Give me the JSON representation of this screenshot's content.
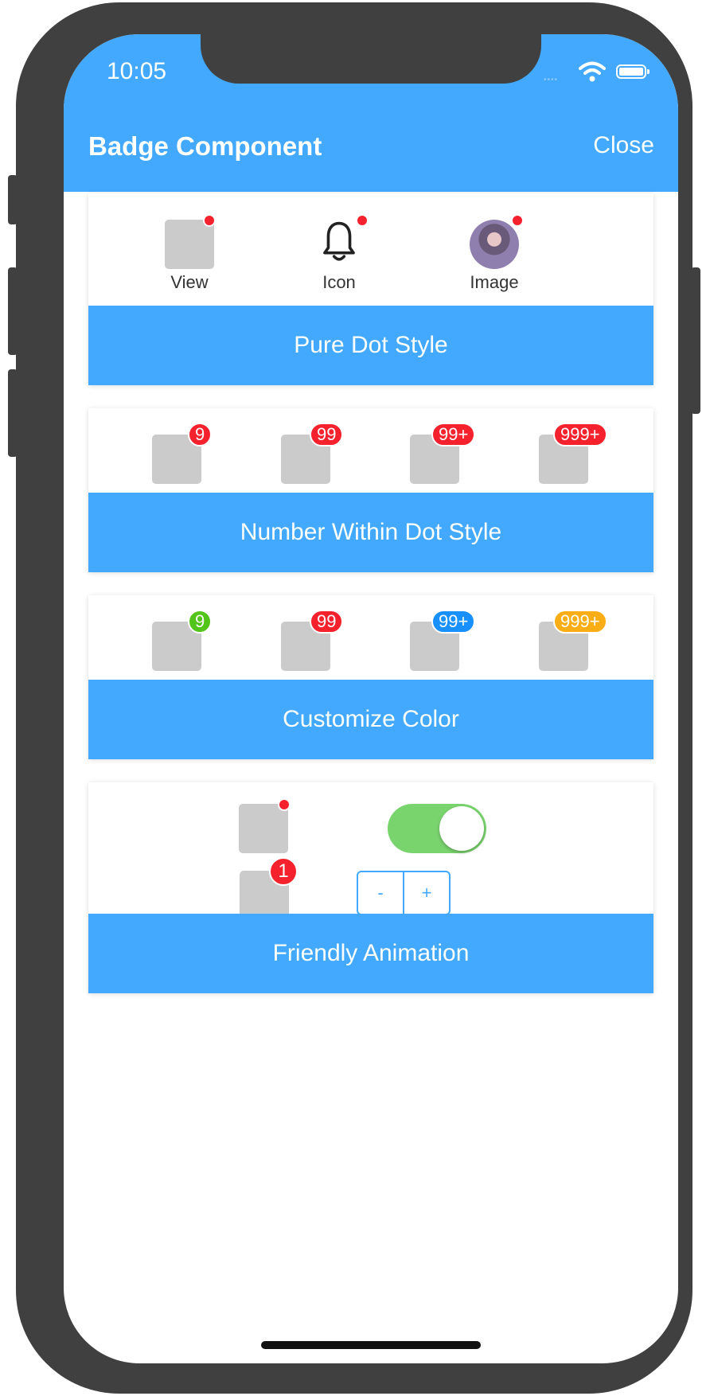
{
  "status_bar": {
    "time": "10:05",
    "signal": "••••"
  },
  "navbar": {
    "title": "Badge Component",
    "close_label": "Close"
  },
  "colors": {
    "primary": "#42a9fe",
    "red": "#f5222d",
    "green": "#52c41a",
    "blue": "#1890ff",
    "orange": "#faad14",
    "switch_on": "#7ad46e"
  },
  "section_dot": {
    "items": [
      {
        "label": "View"
      },
      {
        "label": "Icon",
        "icon": "bell-icon"
      },
      {
        "label": "Image"
      }
    ],
    "footer": "Pure Dot Style"
  },
  "section_number": {
    "badges": [
      "9",
      "99",
      "99+",
      "999+"
    ],
    "footer": "Number Within Dot Style"
  },
  "section_color": {
    "badges": [
      {
        "text": "9",
        "color": "#52c41a"
      },
      {
        "text": "99",
        "color": "#f5222d"
      },
      {
        "text": "99+",
        "color": "#1890ff"
      },
      {
        "text": "999+",
        "color": "#faad14"
      }
    ],
    "footer": "Customize Color"
  },
  "section_animation": {
    "count_badge": "1",
    "switch_on": true,
    "stepper": {
      "minus": "-",
      "plus": "+"
    },
    "footer": "Friendly Animation"
  }
}
